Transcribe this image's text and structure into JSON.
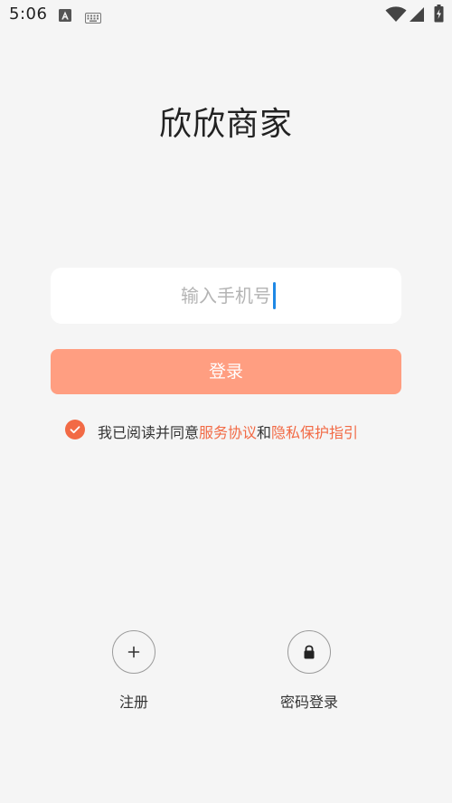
{
  "status_bar": {
    "time": "5:06",
    "icons": [
      "notification-a-icon",
      "keyboard-icon",
      "wifi-icon",
      "signal-icon",
      "battery-icon"
    ]
  },
  "app": {
    "title": "欣欣商家"
  },
  "phone_input": {
    "placeholder": "输入手机号",
    "value": ""
  },
  "login_button": {
    "label": "登录"
  },
  "agreement": {
    "checked": true,
    "prefix": "我已阅读并同意",
    "service_link": "服务协议",
    "conjunction": "和",
    "privacy_link": "隐私保护指引"
  },
  "bottom_actions": {
    "register": {
      "label": "注册",
      "icon": "plus-icon"
    },
    "password_login": {
      "label": "密码登录",
      "icon": "lock-icon"
    }
  },
  "colors": {
    "accent": "#f26a45",
    "button": "#ff9e81",
    "background": "#f5f5f5",
    "caret": "#1e88e5"
  }
}
